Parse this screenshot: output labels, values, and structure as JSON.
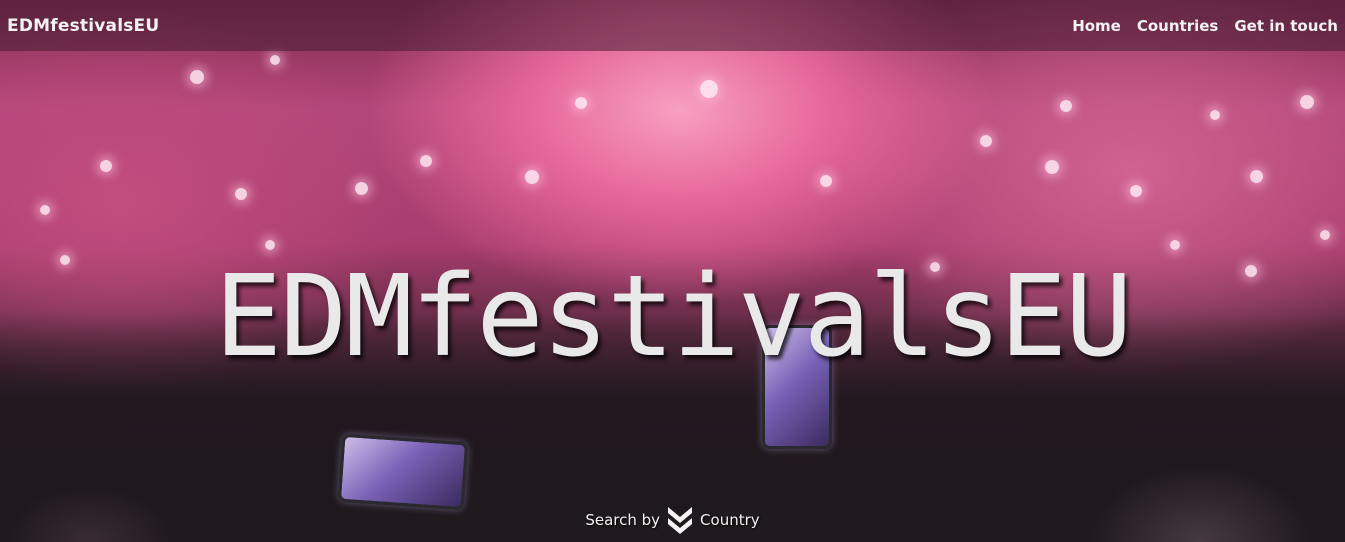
{
  "navbar": {
    "brand": "EDMfestivalsEU",
    "links": [
      {
        "label": "Home"
      },
      {
        "label": "Countries"
      },
      {
        "label": "Get in touch"
      }
    ]
  },
  "hero": {
    "title": "EDMfestivalsEU",
    "search_prefix": "Search by",
    "search_suffix": "Country",
    "scroll_icon": "double-chevron-down-icon"
  },
  "colors": {
    "navbar_overlay": "#461e32",
    "title_text": "#e9e9e9",
    "nav_text": "#f2f2f2"
  }
}
